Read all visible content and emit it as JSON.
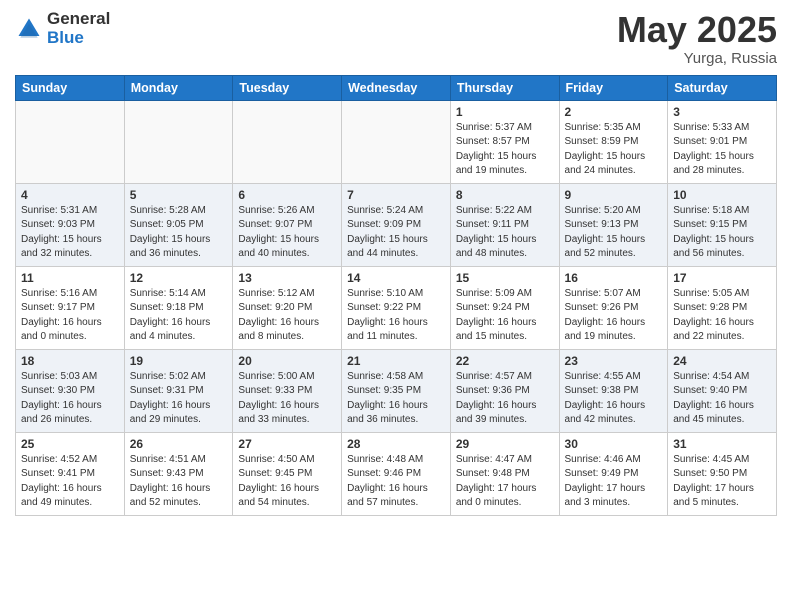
{
  "header": {
    "logo_general": "General",
    "logo_blue": "Blue",
    "title": "May 2025",
    "location": "Yurga, Russia"
  },
  "weekdays": [
    "Sunday",
    "Monday",
    "Tuesday",
    "Wednesday",
    "Thursday",
    "Friday",
    "Saturday"
  ],
  "weeks": [
    [
      {
        "day": "",
        "sunrise": "",
        "sunset": "",
        "daylight": ""
      },
      {
        "day": "",
        "sunrise": "",
        "sunset": "",
        "daylight": ""
      },
      {
        "day": "",
        "sunrise": "",
        "sunset": "",
        "daylight": ""
      },
      {
        "day": "",
        "sunrise": "",
        "sunset": "",
        "daylight": ""
      },
      {
        "day": "1",
        "sunrise": "5:37 AM",
        "sunset": "8:57 PM",
        "daylight": "15 hours and 19 minutes."
      },
      {
        "day": "2",
        "sunrise": "5:35 AM",
        "sunset": "8:59 PM",
        "daylight": "15 hours and 24 minutes."
      },
      {
        "day": "3",
        "sunrise": "5:33 AM",
        "sunset": "9:01 PM",
        "daylight": "15 hours and 28 minutes."
      }
    ],
    [
      {
        "day": "4",
        "sunrise": "5:31 AM",
        "sunset": "9:03 PM",
        "daylight": "15 hours and 32 minutes."
      },
      {
        "day": "5",
        "sunrise": "5:28 AM",
        "sunset": "9:05 PM",
        "daylight": "15 hours and 36 minutes."
      },
      {
        "day": "6",
        "sunrise": "5:26 AM",
        "sunset": "9:07 PM",
        "daylight": "15 hours and 40 minutes."
      },
      {
        "day": "7",
        "sunrise": "5:24 AM",
        "sunset": "9:09 PM",
        "daylight": "15 hours and 44 minutes."
      },
      {
        "day": "8",
        "sunrise": "5:22 AM",
        "sunset": "9:11 PM",
        "daylight": "15 hours and 48 minutes."
      },
      {
        "day": "9",
        "sunrise": "5:20 AM",
        "sunset": "9:13 PM",
        "daylight": "15 hours and 52 minutes."
      },
      {
        "day": "10",
        "sunrise": "5:18 AM",
        "sunset": "9:15 PM",
        "daylight": "15 hours and 56 minutes."
      }
    ],
    [
      {
        "day": "11",
        "sunrise": "5:16 AM",
        "sunset": "9:17 PM",
        "daylight": "16 hours and 0 minutes."
      },
      {
        "day": "12",
        "sunrise": "5:14 AM",
        "sunset": "9:18 PM",
        "daylight": "16 hours and 4 minutes."
      },
      {
        "day": "13",
        "sunrise": "5:12 AM",
        "sunset": "9:20 PM",
        "daylight": "16 hours and 8 minutes."
      },
      {
        "day": "14",
        "sunrise": "5:10 AM",
        "sunset": "9:22 PM",
        "daylight": "16 hours and 11 minutes."
      },
      {
        "day": "15",
        "sunrise": "5:09 AM",
        "sunset": "9:24 PM",
        "daylight": "16 hours and 15 minutes."
      },
      {
        "day": "16",
        "sunrise": "5:07 AM",
        "sunset": "9:26 PM",
        "daylight": "16 hours and 19 minutes."
      },
      {
        "day": "17",
        "sunrise": "5:05 AM",
        "sunset": "9:28 PM",
        "daylight": "16 hours and 22 minutes."
      }
    ],
    [
      {
        "day": "18",
        "sunrise": "5:03 AM",
        "sunset": "9:30 PM",
        "daylight": "16 hours and 26 minutes."
      },
      {
        "day": "19",
        "sunrise": "5:02 AM",
        "sunset": "9:31 PM",
        "daylight": "16 hours and 29 minutes."
      },
      {
        "day": "20",
        "sunrise": "5:00 AM",
        "sunset": "9:33 PM",
        "daylight": "16 hours and 33 minutes."
      },
      {
        "day": "21",
        "sunrise": "4:58 AM",
        "sunset": "9:35 PM",
        "daylight": "16 hours and 36 minutes."
      },
      {
        "day": "22",
        "sunrise": "4:57 AM",
        "sunset": "9:36 PM",
        "daylight": "16 hours and 39 minutes."
      },
      {
        "day": "23",
        "sunrise": "4:55 AM",
        "sunset": "9:38 PM",
        "daylight": "16 hours and 42 minutes."
      },
      {
        "day": "24",
        "sunrise": "4:54 AM",
        "sunset": "9:40 PM",
        "daylight": "16 hours and 45 minutes."
      }
    ],
    [
      {
        "day": "25",
        "sunrise": "4:52 AM",
        "sunset": "9:41 PM",
        "daylight": "16 hours and 49 minutes."
      },
      {
        "day": "26",
        "sunrise": "4:51 AM",
        "sunset": "9:43 PM",
        "daylight": "16 hours and 52 minutes."
      },
      {
        "day": "27",
        "sunrise": "4:50 AM",
        "sunset": "9:45 PM",
        "daylight": "16 hours and 54 minutes."
      },
      {
        "day": "28",
        "sunrise": "4:48 AM",
        "sunset": "9:46 PM",
        "daylight": "16 hours and 57 minutes."
      },
      {
        "day": "29",
        "sunrise": "4:47 AM",
        "sunset": "9:48 PM",
        "daylight": "17 hours and 0 minutes."
      },
      {
        "day": "30",
        "sunrise": "4:46 AM",
        "sunset": "9:49 PM",
        "daylight": "17 hours and 3 minutes."
      },
      {
        "day": "31",
        "sunrise": "4:45 AM",
        "sunset": "9:50 PM",
        "daylight": "17 hours and 5 minutes."
      }
    ]
  ]
}
